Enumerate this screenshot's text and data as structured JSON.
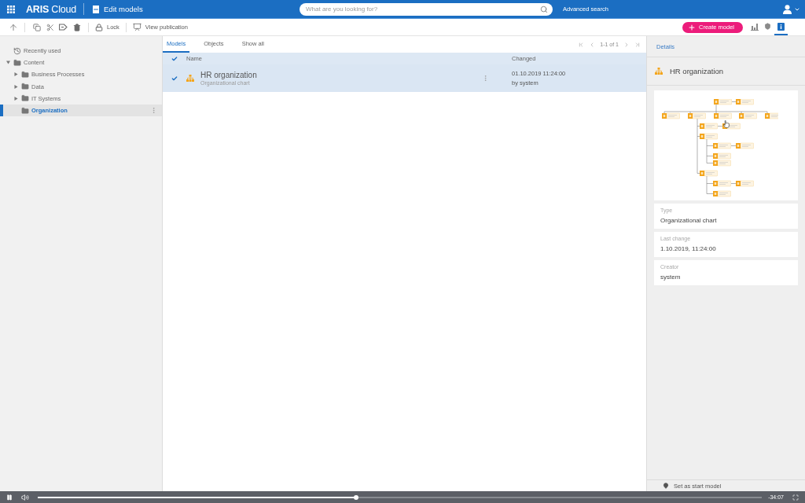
{
  "header": {
    "logo": "**ARIS** Cloud",
    "page_title": "Edit models",
    "search": {
      "placeholder": "What are you looking for?"
    },
    "advanced_search": "Advanced search"
  },
  "toolbar": {
    "lock": "Lock",
    "view_publication": "View publication",
    "create_button": "Create model",
    "view_buttons": [
      {
        "selected": false
      },
      {
        "selected": false
      },
      {
        "selected": true
      }
    ]
  },
  "tree": [
    {
      "kind": "recent",
      "label": "Recently used",
      "selected": false
    },
    {
      "kind": "folder",
      "label": "Content",
      "expanded": true,
      "selected": false,
      "children": [
        {
          "kind": "folder",
          "label": "Business Processes",
          "expanded": false,
          "selected": false
        },
        {
          "kind": "folder",
          "label": "Data",
          "expanded": false,
          "selected": false
        },
        {
          "kind": "folder",
          "label": "IT Systems",
          "expanded": false,
          "selected": false
        },
        {
          "kind": "folder",
          "label": "Organization",
          "selected": true
        }
      ]
    }
  ],
  "tabs": [
    {
      "label": "Models",
      "selected": true
    },
    {
      "label": "Objects",
      "selected": false
    },
    {
      "label": "Show all",
      "selected": false
    }
  ],
  "pagination": "1-1 of 1",
  "table": {
    "all_checked": true,
    "columns": [
      "Name",
      "Changed"
    ],
    "rows": [
      {
        "selected": true,
        "checked": true,
        "name": "HR organization",
        "type": "Organizational chart",
        "changed": "01.10.2019 11:24:00",
        "changed_by": "by system"
      }
    ]
  },
  "details": {
    "tab": "Details",
    "title": "HR organization",
    "properties": [
      {
        "label": "Type",
        "value": "Organizational chart"
      },
      {
        "label": "Last change",
        "value": "1.10.2019, 11:24:00"
      },
      {
        "label": "Creator",
        "value": "system"
      }
    ],
    "start_model_button": "Set as start model"
  },
  "video_player": {
    "playing": true,
    "progress": {
      "level": 0.44
    },
    "time": "-34:07"
  }
}
